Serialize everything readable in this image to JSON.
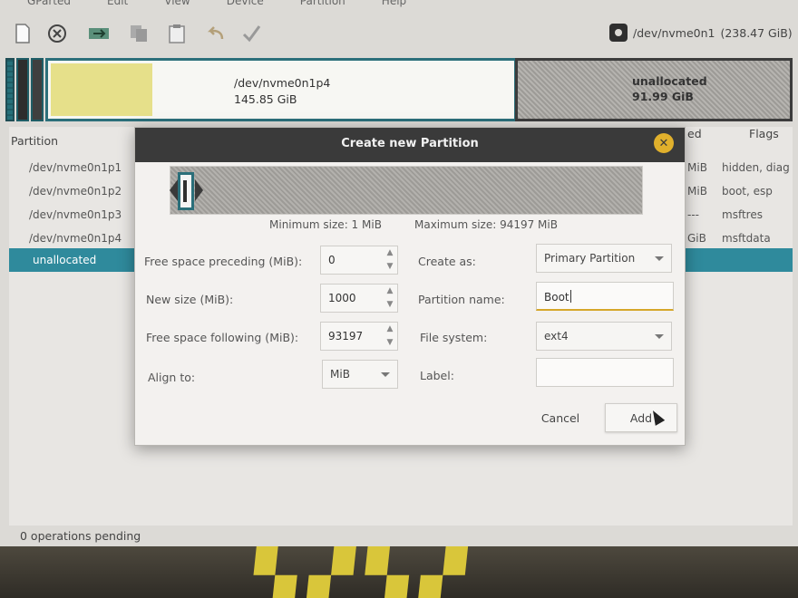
{
  "menubar": {
    "items": [
      "GParted",
      "Edit",
      "View",
      "Device",
      "Partition",
      "Help"
    ]
  },
  "toolbar": {
    "buttons": [
      {
        "icon": "new-icon"
      },
      {
        "icon": "delete-icon"
      },
      {
        "icon": "resize-move-icon"
      },
      {
        "icon": "copy-icon"
      },
      {
        "icon": "paste-icon"
      },
      {
        "icon": "undo-icon"
      },
      {
        "icon": "apply-icon"
      }
    ],
    "device": "/dev/nvme0n1",
    "device_size": "(238.47 GiB)"
  },
  "disk_map": {
    "p4_name": "/dev/nvme0n1p4",
    "p4_size": "145.85 GiB",
    "unalloc_name": "unallocated",
    "unalloc_size": "91.99 GiB"
  },
  "list": {
    "col_partition": "Partition",
    "col_used": "ed",
    "col_flags": "Flags",
    "rows": [
      {
        "name": "/dev/nvme0n1p1",
        "used": "MiB",
        "flags": "hidden, diag"
      },
      {
        "name": "/dev/nvme0n1p2",
        "used": "MiB",
        "flags": "boot, esp"
      },
      {
        "name": "/dev/nvme0n1p3",
        "used": "---",
        "flags": "msftres"
      },
      {
        "name": "/dev/nvme0n1p4",
        "used": "GiB",
        "flags": "msftdata"
      },
      {
        "name": "unallocated",
        "used": "",
        "flags": ""
      }
    ]
  },
  "status": "0 operations pending",
  "dialog": {
    "title": "Create new Partition",
    "min_size": "Minimum size: 1 MiB",
    "max_size": "Maximum size: 94197 MiB",
    "free_preceding_label": "Free space preceding (MiB):",
    "free_preceding_value": "0",
    "new_size_label": "New size (MiB):",
    "new_size_value": "1000",
    "free_following_label": "Free space following (MiB):",
    "free_following_value": "93197",
    "align_label": "Align to:",
    "align_value": "MiB",
    "create_as_label": "Create as:",
    "create_as_value": "Primary Partition",
    "partition_name_label": "Partition name:",
    "partition_name_value": "Boot",
    "file_system_label": "File system:",
    "file_system_value": "ext4",
    "label_label": "Label:",
    "label_value": "",
    "cancel": "Cancel",
    "add": "Add"
  },
  "colors": {
    "selection": "#2f8a9c",
    "partition_border": "#2b6f7a",
    "used_fill": "#e6e08a",
    "titlebar": "#3a3a3a",
    "close_button": "#e0b02c",
    "focus_underline": "#d6a72a"
  }
}
